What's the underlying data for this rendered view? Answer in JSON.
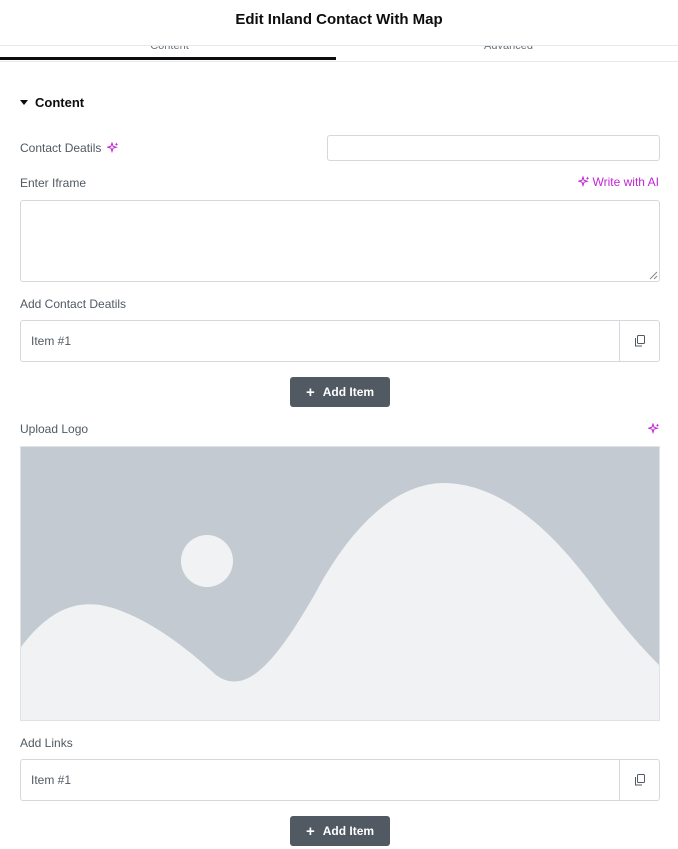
{
  "header": {
    "title": "Edit Inland Contact With Map"
  },
  "tabs": [
    {
      "label": "Content",
      "active": true
    },
    {
      "label": "Advanced",
      "active": false
    }
  ],
  "section": {
    "label": "Content",
    "expanded": true
  },
  "contact_details": {
    "label": "Contact Deatils",
    "value": "",
    "icon": "ai-sparkle-icon"
  },
  "iframe": {
    "label": "Enter Iframe",
    "value": "",
    "ai_button": "Write with AI"
  },
  "add_contact_details": {
    "label": "Add Contact Deatils",
    "items": [
      {
        "title": "Item #1"
      }
    ],
    "add_label": "Add Item"
  },
  "upload_logo": {
    "label": "Upload Logo",
    "icon": "ai-sparkle-icon",
    "placeholder": "image-placeholder"
  },
  "add_links": {
    "label": "Add Links",
    "items": [
      {
        "title": "Item #1"
      }
    ],
    "add_label": "Add Item"
  },
  "colors": {
    "accent_ai": "#c026d3",
    "button_bg": "#515962",
    "placeholder_bg": "#c3cad1",
    "placeholder_fg": "#f1f2f3"
  }
}
